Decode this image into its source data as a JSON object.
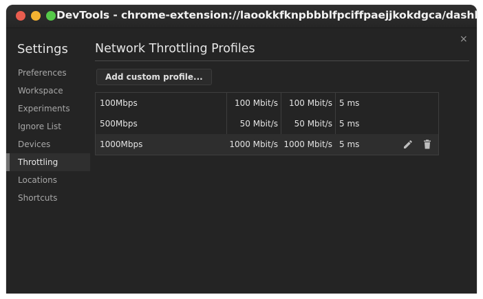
{
  "window": {
    "title": "DevTools - chrome-extension://laookkfknpbbblfpciffpaejjkokdgca/dashboard.html"
  },
  "close_label": "×",
  "settings": {
    "title": "Settings",
    "sidebar_items": [
      {
        "label": "Preferences"
      },
      {
        "label": "Workspace"
      },
      {
        "label": "Experiments"
      },
      {
        "label": "Ignore List"
      },
      {
        "label": "Devices"
      },
      {
        "label": "Throttling"
      },
      {
        "label": "Locations"
      },
      {
        "label": "Shortcuts"
      }
    ],
    "active_item": "Throttling"
  },
  "panel": {
    "title": "Network Throttling Profiles",
    "add_button_label": "Add custom profile...",
    "profiles": [
      {
        "name": "100Mbps",
        "download": "100 Mbit/s",
        "upload": "100 Mbit/s",
        "latency": "5 ms"
      },
      {
        "name": "500Mbps",
        "download": "50 Mbit/s",
        "upload": "50 Mbit/s",
        "latency": "5 ms"
      },
      {
        "name": "1000Mbps",
        "download": "1000 Mbit/s",
        "upload": "1000 Mbit/s",
        "latency": "5 ms"
      }
    ]
  },
  "icons": {
    "edit": "pencil-icon",
    "delete": "trash-icon"
  },
  "colors": {
    "window_bg": "#242424",
    "titlebar_bg": "#2f2f2f",
    "traffic_close": "#e95d4f",
    "traffic_min": "#f5b332",
    "traffic_max": "#55c949"
  }
}
